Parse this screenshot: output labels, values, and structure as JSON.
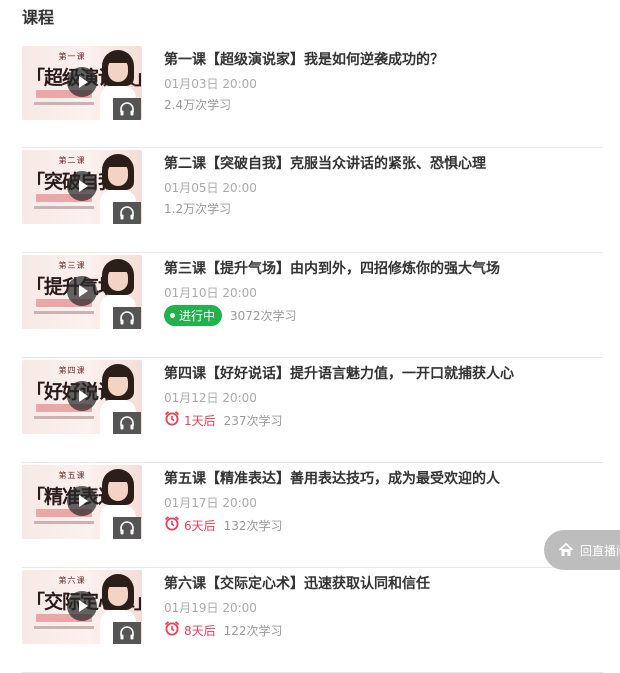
{
  "section_title": "课程",
  "lessons": [
    {
      "thumb_no": "第一课",
      "thumb_title": "「超级演说家」",
      "title": "第一课【超级演说家】我是如何逆袭成功的？",
      "date": "01月03日 20:00",
      "status": "",
      "count": "2.4万次学习"
    },
    {
      "thumb_no": "第二课",
      "thumb_title": "「突破自我」",
      "title": "第二课【突破自我】克服当众讲话的紧张、恐惧心理",
      "date": "01月05日 20:00",
      "status": "",
      "count": "1.2万次学习"
    },
    {
      "thumb_no": "第三课",
      "thumb_title": "「提升气场」",
      "title": "第三课【提升气场】由内到外，四招修炼你的强大气场",
      "date": "01月10日 20:00",
      "status": "进行中",
      "count": "3072次学习"
    },
    {
      "thumb_no": "第四课",
      "thumb_title": "「好好说话」",
      "title": "第四课【好好说话】提升语言魅力值，一开口就捕获人心",
      "date": "01月12日 20:00",
      "status": "1天后",
      "count": "237次学习"
    },
    {
      "thumb_no": "第五课",
      "thumb_title": "「精准表达」",
      "title": "第五课【精准表达】善用表达技巧，成为最受欢迎的人",
      "date": "01月17日 20:00",
      "status": "6天后",
      "count": "132次学习"
    },
    {
      "thumb_no": "第六课",
      "thumb_title": "「交际定心术」",
      "title": "第六课【交际定心术】迅速获取认同和信任",
      "date": "01月19日 20:00",
      "status": "8天后",
      "count": "122次学习"
    }
  ],
  "floating_button": {
    "label": "回直播间",
    "icon": "home-icon"
  },
  "colors": {
    "live": "#23b14d",
    "countdown": "#e54059",
    "muted": "#999999"
  }
}
